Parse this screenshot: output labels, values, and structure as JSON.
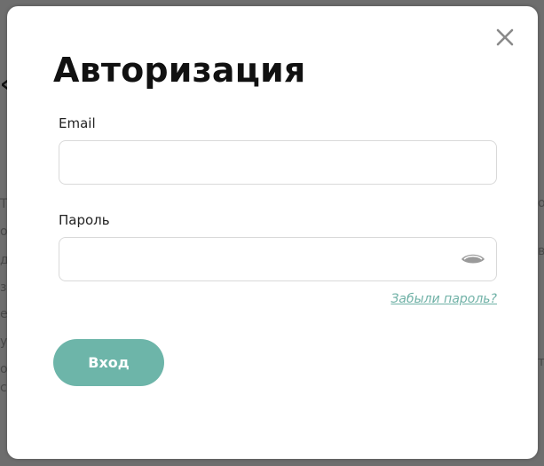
{
  "modal": {
    "title": "Авторизация",
    "close_icon": "close-icon"
  },
  "form": {
    "email_label": "Email",
    "email_value": "",
    "email_placeholder": "",
    "password_label": "Пароль",
    "password_value": "",
    "password_placeholder": "",
    "eye_icon": "eye-icon",
    "forgot_label": "Забыли пароль?",
    "submit_label": "Вход"
  },
  "colors": {
    "accent": "#6db5a9",
    "link": "#6fb1a6",
    "overlay": "#6e6e6e",
    "border": "#d9d9d9"
  }
}
